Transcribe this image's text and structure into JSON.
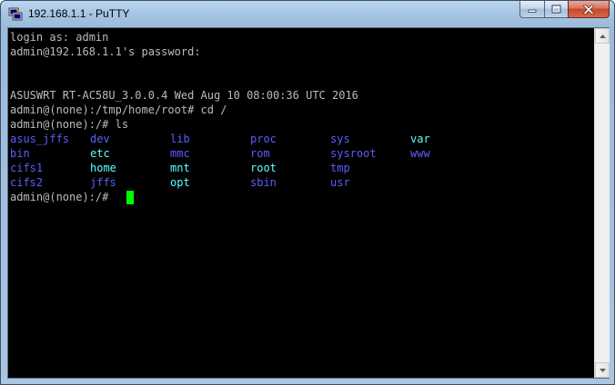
{
  "window": {
    "title": "192.168.1.1 - PuTTY"
  },
  "icons": {
    "app": "putty-icon",
    "minimize": "minimize-icon",
    "maximize": "maximize-icon",
    "close": "close-icon"
  },
  "colors": {
    "terminal_bg": "#000000",
    "terminal_fg": "#bbbbbb",
    "dir": "#5c5cff",
    "link": "#5cffff",
    "exec": "#5cff5c",
    "cursor": "#00ff00"
  },
  "terminal": {
    "lines": [
      "login as: admin",
      "admin@192.168.1.1's password:",
      "",
      "",
      "ASUSWRT RT-AC58U_3.0.0.4 Wed Aug 10 08:00:36 UTC 2016",
      "admin@(none):/tmp/home/root# cd /",
      "admin@(none):/# ls"
    ],
    "ls_output": [
      [
        {
          "name": "asus_jffs",
          "kind": "dir"
        },
        {
          "name": "dev",
          "kind": "dir"
        },
        {
          "name": "lib",
          "kind": "dir"
        },
        {
          "name": "proc",
          "kind": "dir"
        },
        {
          "name": "sys",
          "kind": "dir"
        },
        {
          "name": "var",
          "kind": "link"
        }
      ],
      [
        {
          "name": "bin",
          "kind": "dir"
        },
        {
          "name": "etc",
          "kind": "link"
        },
        {
          "name": "mmc",
          "kind": "dir"
        },
        {
          "name": "rom",
          "kind": "dir"
        },
        {
          "name": "sysroot",
          "kind": "dir"
        },
        {
          "name": "www",
          "kind": "dir"
        }
      ],
      [
        {
          "name": "cifs1",
          "kind": "dir"
        },
        {
          "name": "home",
          "kind": "link"
        },
        {
          "name": "mnt",
          "kind": "link"
        },
        {
          "name": "root",
          "kind": "link"
        },
        {
          "name": "tmp",
          "kind": "dir"
        }
      ],
      [
        {
          "name": "cifs2",
          "kind": "dir"
        },
        {
          "name": "jffs",
          "kind": "dir"
        },
        {
          "name": "opt",
          "kind": "link"
        },
        {
          "name": "sbin",
          "kind": "dir"
        },
        {
          "name": "usr",
          "kind": "dir"
        }
      ]
    ],
    "prompt": "admin@(none):/# "
  }
}
